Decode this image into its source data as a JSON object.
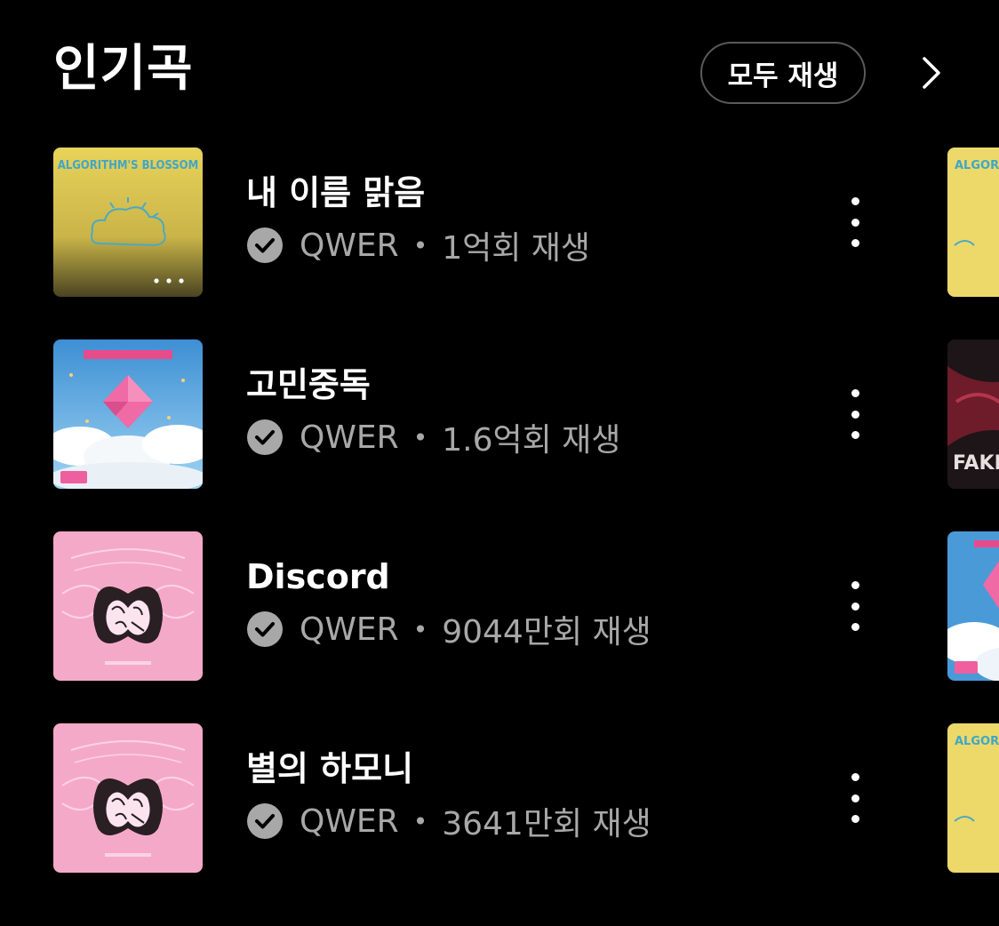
{
  "header": {
    "title": "인기곡",
    "play_all_label": "모두 재생"
  },
  "songs": [
    {
      "title": "내 이름 맑음",
      "artist": "QWER",
      "separator": "•",
      "plays": "1억회 재생",
      "cover_text": "ALGORITHM'S BLOSSOM",
      "cover_style": "yellow"
    },
    {
      "title": "고민중독",
      "artist": "QWER",
      "separator": "•",
      "plays": "1.6억회 재생",
      "cover_style": "sky"
    },
    {
      "title": "Discord",
      "artist": "QWER",
      "separator": "•",
      "plays": "9044만회 재생",
      "cover_style": "pink"
    },
    {
      "title": "별의 하모니",
      "artist": "QWER",
      "separator": "•",
      "plays": "3641만회 재생",
      "cover_style": "pink"
    }
  ],
  "peek_column": [
    {
      "cover_text": "ALGORIT",
      "cover_style": "yellow"
    },
    {
      "cover_text": "FAKE",
      "cover_style": "dark-red"
    },
    {
      "cover_style": "sky"
    },
    {
      "cover_text": "ALGORIT",
      "cover_style": "yellow"
    }
  ],
  "icons": {
    "verified": "check-circle-icon",
    "more": "more-vertical-icon",
    "next": "chevron-right-icon"
  }
}
